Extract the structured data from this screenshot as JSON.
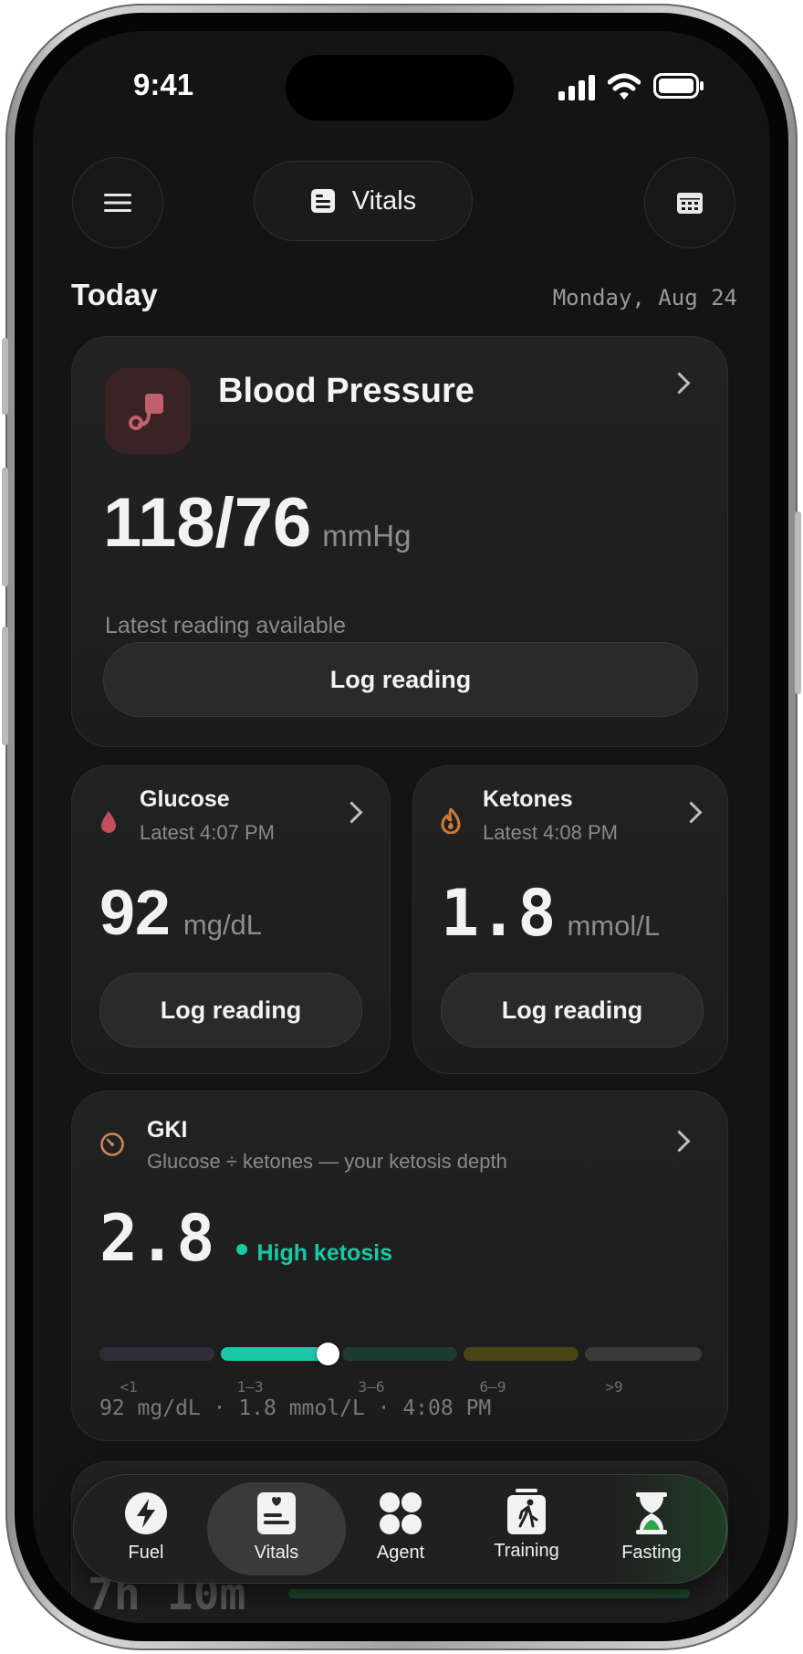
{
  "status_bar": {
    "time": "9:41"
  },
  "header": {
    "title": "Vitals"
  },
  "date_row": {
    "today_label": "Today",
    "date": "Monday, Aug 24"
  },
  "blood_pressure": {
    "title": "Blood Pressure",
    "value": "118/76",
    "unit": "mmHg",
    "subtitle": "Latest reading available",
    "button_label": "Log reading"
  },
  "glucose": {
    "title": "Glucose",
    "latest": "Latest 4:07 PM",
    "value": "92",
    "unit": "mg/dL",
    "button_label": "Log reading"
  },
  "ketones": {
    "title": "Ketones",
    "latest": "Latest 4:08 PM",
    "value": "1.8",
    "unit": "mmol/L",
    "button_label": "Log reading"
  },
  "gki": {
    "title": "GKI",
    "subtitle": "Glucose ÷ ketones — your ketosis depth",
    "value": "2.8",
    "status": "High ketosis",
    "scale_labels": [
      "<1",
      "1–3",
      "3–6",
      "6–9",
      ">9"
    ],
    "footer": "92 mg/dL · 1.8 mmol/L · 4:08 PM"
  },
  "next_card": {
    "value": "7h 10m"
  },
  "tab_bar": {
    "tabs": [
      {
        "label": "Fuel",
        "icon": "bolt-icon"
      },
      {
        "label": "Vitals",
        "icon": "vitals-icon"
      },
      {
        "label": "Agent",
        "icon": "agent-icon"
      },
      {
        "label": "Training",
        "icon": "training-icon"
      },
      {
        "label": "Fasting",
        "icon": "hourglass-icon"
      }
    ]
  },
  "colors": {
    "accent_teal": "#17c9a6",
    "bp_icon_bg": "#3a2325",
    "bp_icon": "#c0606c",
    "glucose_drop": "#c2505a",
    "ketone_flame": "#d07a3a",
    "gki_icon": "#c9885a"
  }
}
